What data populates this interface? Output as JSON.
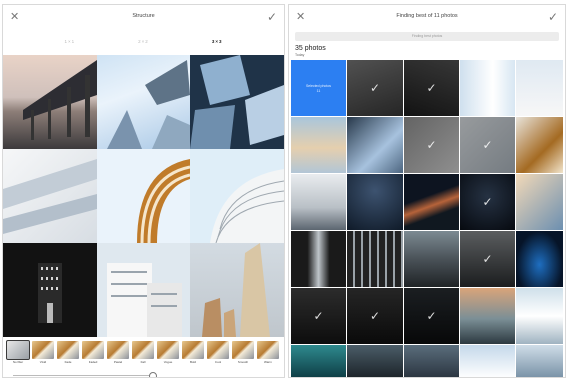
{
  "left": {
    "close_glyph": "✕",
    "title": "Structure",
    "confirm_glyph": "✓",
    "grid_tabs": [
      {
        "label": "1×1",
        "active": false
      },
      {
        "label": "2×2",
        "active": false
      },
      {
        "label": "3×3",
        "active": true
      }
    ],
    "filters": [
      {
        "label": "No filter"
      },
      {
        "label": "Vivid"
      },
      {
        "label": "Fade"
      },
      {
        "label": "Faded"
      },
      {
        "label": "Pastel"
      },
      {
        "label": "Fall"
      },
      {
        "label": "Vogue"
      },
      {
        "label": "Bold"
      },
      {
        "label": "Cool"
      },
      {
        "label": "Smooth"
      },
      {
        "label": "Warm"
      },
      {
        "label": "Dusty"
      }
    ]
  },
  "right": {
    "close_glyph": "✕",
    "title": "Finding best of 11 photos",
    "progress_text": "Finding best photos",
    "count": "35 photos",
    "sub": "Today",
    "first_cell_text": "Selected photos\n11",
    "tick_glyph": "✓"
  },
  "colors": {
    "accent_blue": "#2c7ff2",
    "panel_border": "#d9d9d9"
  }
}
